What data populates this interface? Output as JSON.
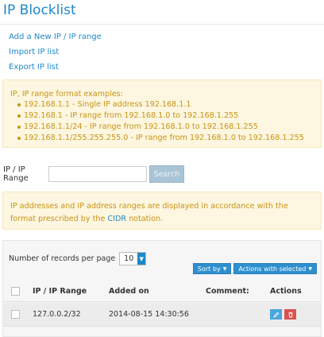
{
  "page": {
    "title": "IP Blocklist"
  },
  "links": [
    {
      "label": "Add a New IP / IP range"
    },
    {
      "label": "Import IP list"
    },
    {
      "label": "Export IP list"
    }
  ],
  "format_info": {
    "heading": "IP, IP range format examples:",
    "items": [
      "192.168.1.1 - Single IP address 192.168.1.1",
      "192.168.1 - IP range from 192.168.1.0 to 192.168.1.255",
      "192.168.1.1/24 - IP range from 192.168.1.0 to 192.168.1.255",
      "192.168.1.1/255.255.255.0 - IP range from 192.168.1.0 to 192.168.1.255"
    ]
  },
  "search": {
    "label": "IP / IP Range",
    "value": "",
    "placeholder": "",
    "button_label": "Search"
  },
  "cidr_info": {
    "text_before": "IP addresses and IP address ranges are displayed in accordance with the format prescribed by the ",
    "link": "CIDR",
    "text_after": " notation."
  },
  "table": {
    "per_page_label": "Number of records per page",
    "per_page_value": "10",
    "sort_label": "Sort by",
    "bulk_label": "Actions with selected",
    "columns": {
      "ip": "IP / IP Range",
      "added": "Added on",
      "comment": "Comment:",
      "actions": "Actions"
    },
    "rows": [
      {
        "ip": "127.0.0.2/32",
        "added": "2014-08-15 14:30:56",
        "comment": ""
      }
    ]
  },
  "icons": {
    "edit": "pencil-icon",
    "delete": "trash-icon",
    "dropdown": "chevron-down-icon"
  },
  "colors": {
    "accent": "#1e88c8",
    "info_bg": "#fdf6e0",
    "info_text": "#c99415",
    "edit_button": "#4aa6de",
    "delete_button": "#d9534f"
  }
}
